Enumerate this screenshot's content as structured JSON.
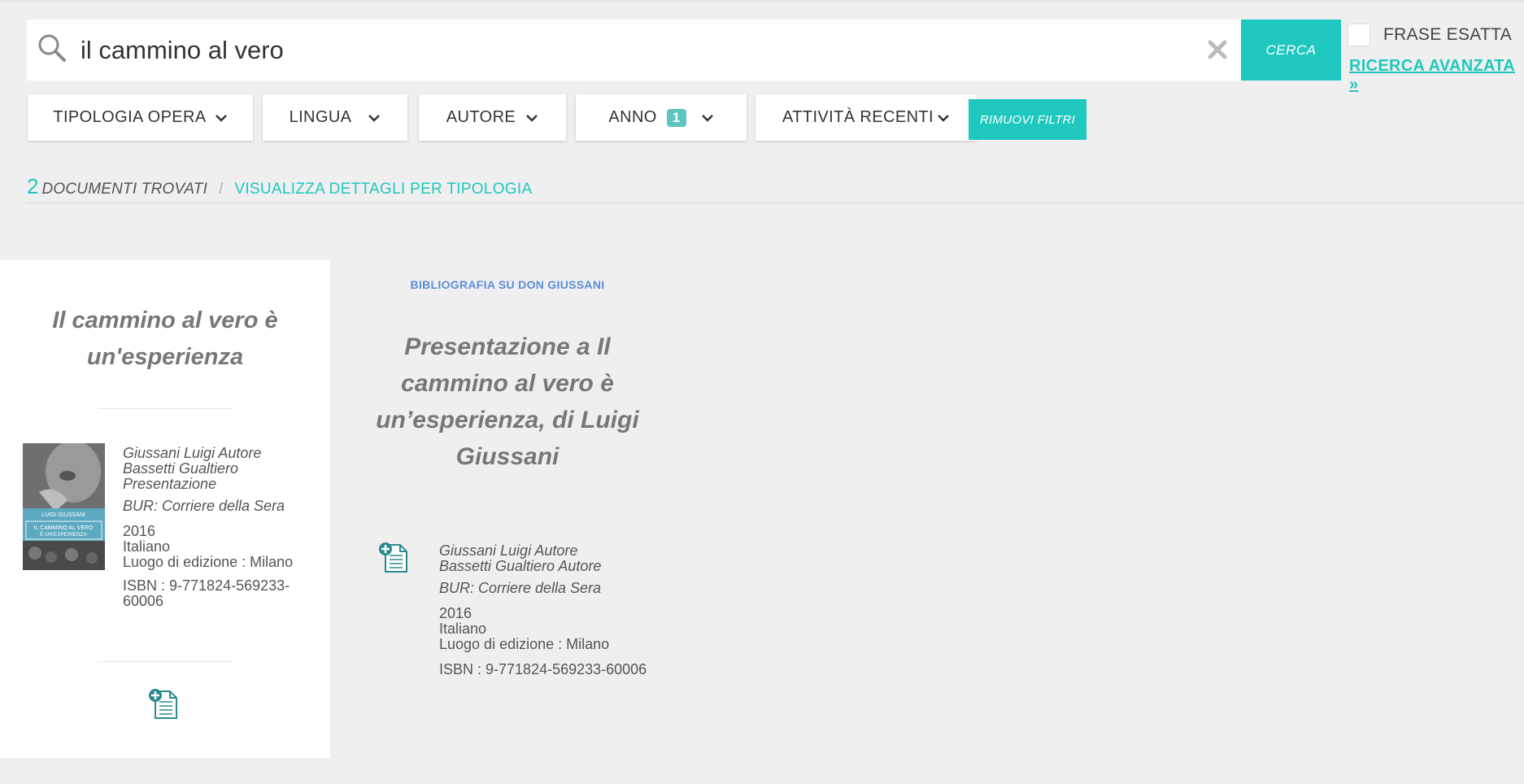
{
  "search": {
    "value": "il cammino al vero",
    "button_label": "CERCA",
    "exact_phrase_label": "FRASE ESATTA",
    "advanced_link": "RICERCA AVANZATA »"
  },
  "filters": [
    {
      "label": "TIPOLOGIA OPERA"
    },
    {
      "label": "LINGUA"
    },
    {
      "label": "AUTORE"
    },
    {
      "label": "ANNO",
      "badge": "1"
    },
    {
      "label": "ATTIVITÀ RECENTI"
    }
  ],
  "remove_filters_label": "RIMUOVI FILTRI",
  "results": {
    "count": "2",
    "found_label": "DOCUMENTI TROVATI",
    "separator": "/",
    "view_details_link": "VISUALIZZA DETTAGLI PER TIPOLOGIA"
  },
  "cards": [
    {
      "title": "Il cammino al vero è un'esperienza",
      "cover_text": {
        "author": "LUIGI GIUSSANI",
        "line1": "IL CAMMINO AL VERO",
        "line2": "È UN'ESPERIENZA"
      },
      "authors": [
        "Giussani Luigi Autore",
        "Bassetti Gualtiero Presentazione"
      ],
      "publisher": "BUR: Corriere della Sera",
      "year": "2016",
      "language": "Italiano",
      "place": "Luogo di edizione : Milano",
      "isbn": "ISBN : 9-771824-569233-60006"
    },
    {
      "tag": "BIBLIOGRAFIA SU DON GIUSSANI",
      "title": "Presentazione a Il cammino al vero è un’esperienza, di Luigi Giussani",
      "authors": [
        "Giussani Luigi Autore",
        "Bassetti Gualtiero Autore"
      ],
      "publisher": "BUR: Corriere della Sera",
      "year": "2016",
      "language": "Italiano",
      "place": "Luogo di edizione : Milano",
      "isbn": "ISBN : 9-771824-569233-60006"
    }
  ],
  "colors": {
    "accent": "#1ec8be",
    "tag_blue": "#5b8ed6",
    "badge": "#5ec4c1",
    "icon_teal": "#2b8a8c"
  },
  "icons": [
    "search-icon",
    "clear-icon",
    "chevron-down-icon",
    "add-document-icon"
  ]
}
